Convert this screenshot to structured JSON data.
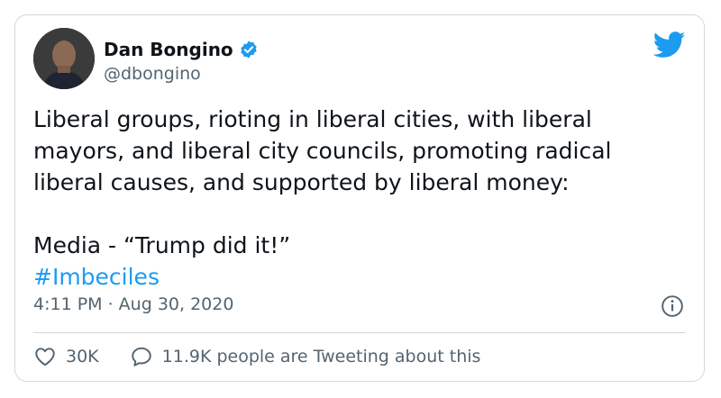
{
  "author": {
    "name": "Dan Bongino",
    "handle": "@dbongino"
  },
  "tweet": {
    "text": "Liberal groups, rioting in liberal cities, with liberal\nmayors, and liberal city councils, promoting radical\nliberal causes, and supported by liberal money:\n\nMedia - “Trump did it!”",
    "hashtag": "#Imbeciles",
    "timestamp": "4:11 PM · Aug 30, 2020"
  },
  "engagement": {
    "likes": "30K",
    "conversation": "11.9K people are Tweeting about this"
  },
  "colors": {
    "brand": "#1d9bf0",
    "text": "#0f1419",
    "muted": "#536471",
    "border": "#cfd9de"
  },
  "icons": [
    "verified-badge-icon",
    "twitter-bird-icon",
    "info-icon",
    "heart-icon",
    "reply-bubble-icon"
  ]
}
